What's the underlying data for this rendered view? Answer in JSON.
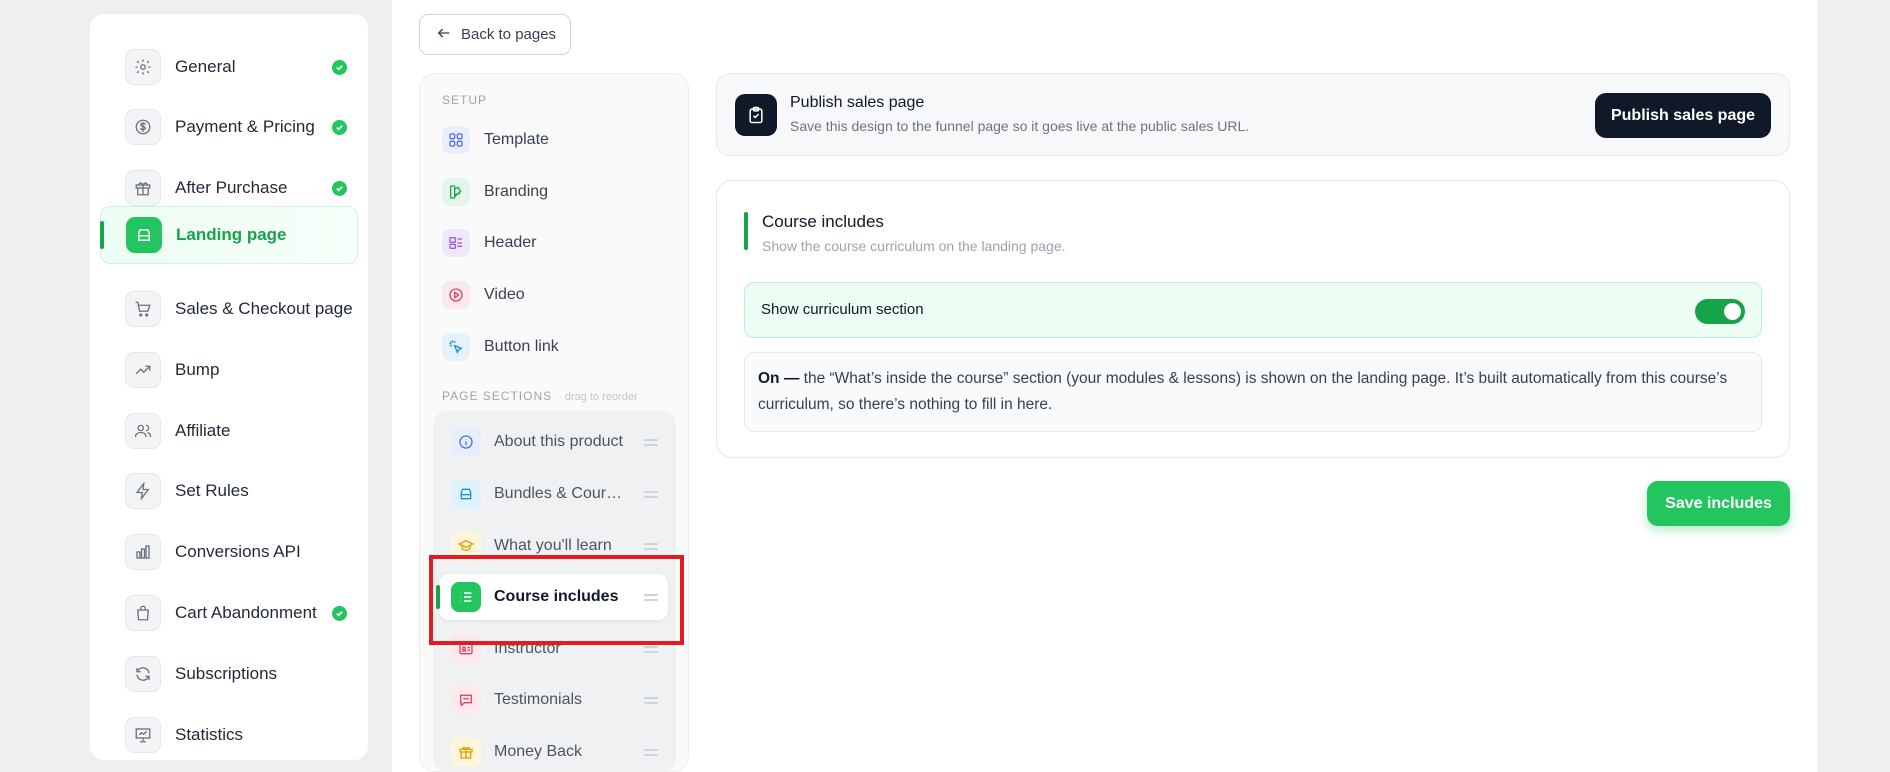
{
  "nav": {
    "items": [
      {
        "label": "General",
        "icon": "gear-icon",
        "done": true
      },
      {
        "label": "Payment & Pricing",
        "icon": "dollar-icon",
        "done": true
      },
      {
        "label": "After Purchase",
        "icon": "gift-icon",
        "done": true
      },
      {
        "label": "Landing page",
        "icon": "layout-icon",
        "done": false,
        "active": true
      },
      {
        "label": "Sales & Checkout page",
        "icon": "cart-icon",
        "done": false
      },
      {
        "label": "Bump",
        "icon": "trend-icon",
        "done": false
      },
      {
        "label": "Affiliate",
        "icon": "users-icon",
        "done": false
      },
      {
        "label": "Set Rules",
        "icon": "bolt-icon",
        "done": false
      },
      {
        "label": "Conversions API",
        "icon": "bar-chart-icon",
        "done": false
      },
      {
        "label": "Cart Abandonment",
        "icon": "bag-icon",
        "done": true
      },
      {
        "label": "Subscriptions",
        "icon": "refresh-icon",
        "done": false
      },
      {
        "label": "Statistics",
        "icon": "presentation-icon",
        "done": false
      }
    ]
  },
  "back_label": "Back to pages",
  "editor": {
    "setup_heading": "SETUP",
    "setup_items": [
      {
        "label": "Template",
        "icon": "grid-icon"
      },
      {
        "label": "Branding",
        "icon": "palette-icon"
      },
      {
        "label": "Header",
        "icon": "header-icon"
      },
      {
        "label": "Video",
        "icon": "play-icon"
      },
      {
        "label": "Button link",
        "icon": "click-icon"
      }
    ],
    "sections_heading": "PAGE SECTIONS",
    "sections_hint": "· drag to reorder",
    "sections": [
      {
        "label": "About this product",
        "icon": "info-icon"
      },
      {
        "label": "Bundles & Courses",
        "icon": "box-icon"
      },
      {
        "label": "What you'll learn",
        "icon": "graduation-cap-icon"
      },
      {
        "label": "Course includes",
        "icon": "list-icon",
        "active": true
      },
      {
        "label": "Instructor",
        "icon": "id-card-icon"
      },
      {
        "label": "Testimonials",
        "icon": "chat-icon"
      },
      {
        "label": "Money Back",
        "icon": "gift-icon"
      }
    ]
  },
  "publish": {
    "title": "Publish sales page",
    "subtitle": "Save this design to the funnel page so it goes live at the public sales URL.",
    "button": "Publish sales page"
  },
  "includes": {
    "title": "Course includes",
    "subtitle": "Show the course curriculum on the landing page.",
    "toggle_label": "Show curriculum section",
    "toggle_on": true,
    "note_strong": "On —",
    "note_text": " the “What’s inside the course” section (your modules & lessons) is shown on the landing page. It’s built automatically from this course’s curriculum, so there’s nothing to fill in here."
  },
  "save_label": "Save includes",
  "colors": {
    "accent": "#16a34a",
    "accent_light": "#22c55e",
    "dark": "#111827",
    "highlight": "#e11d24"
  }
}
